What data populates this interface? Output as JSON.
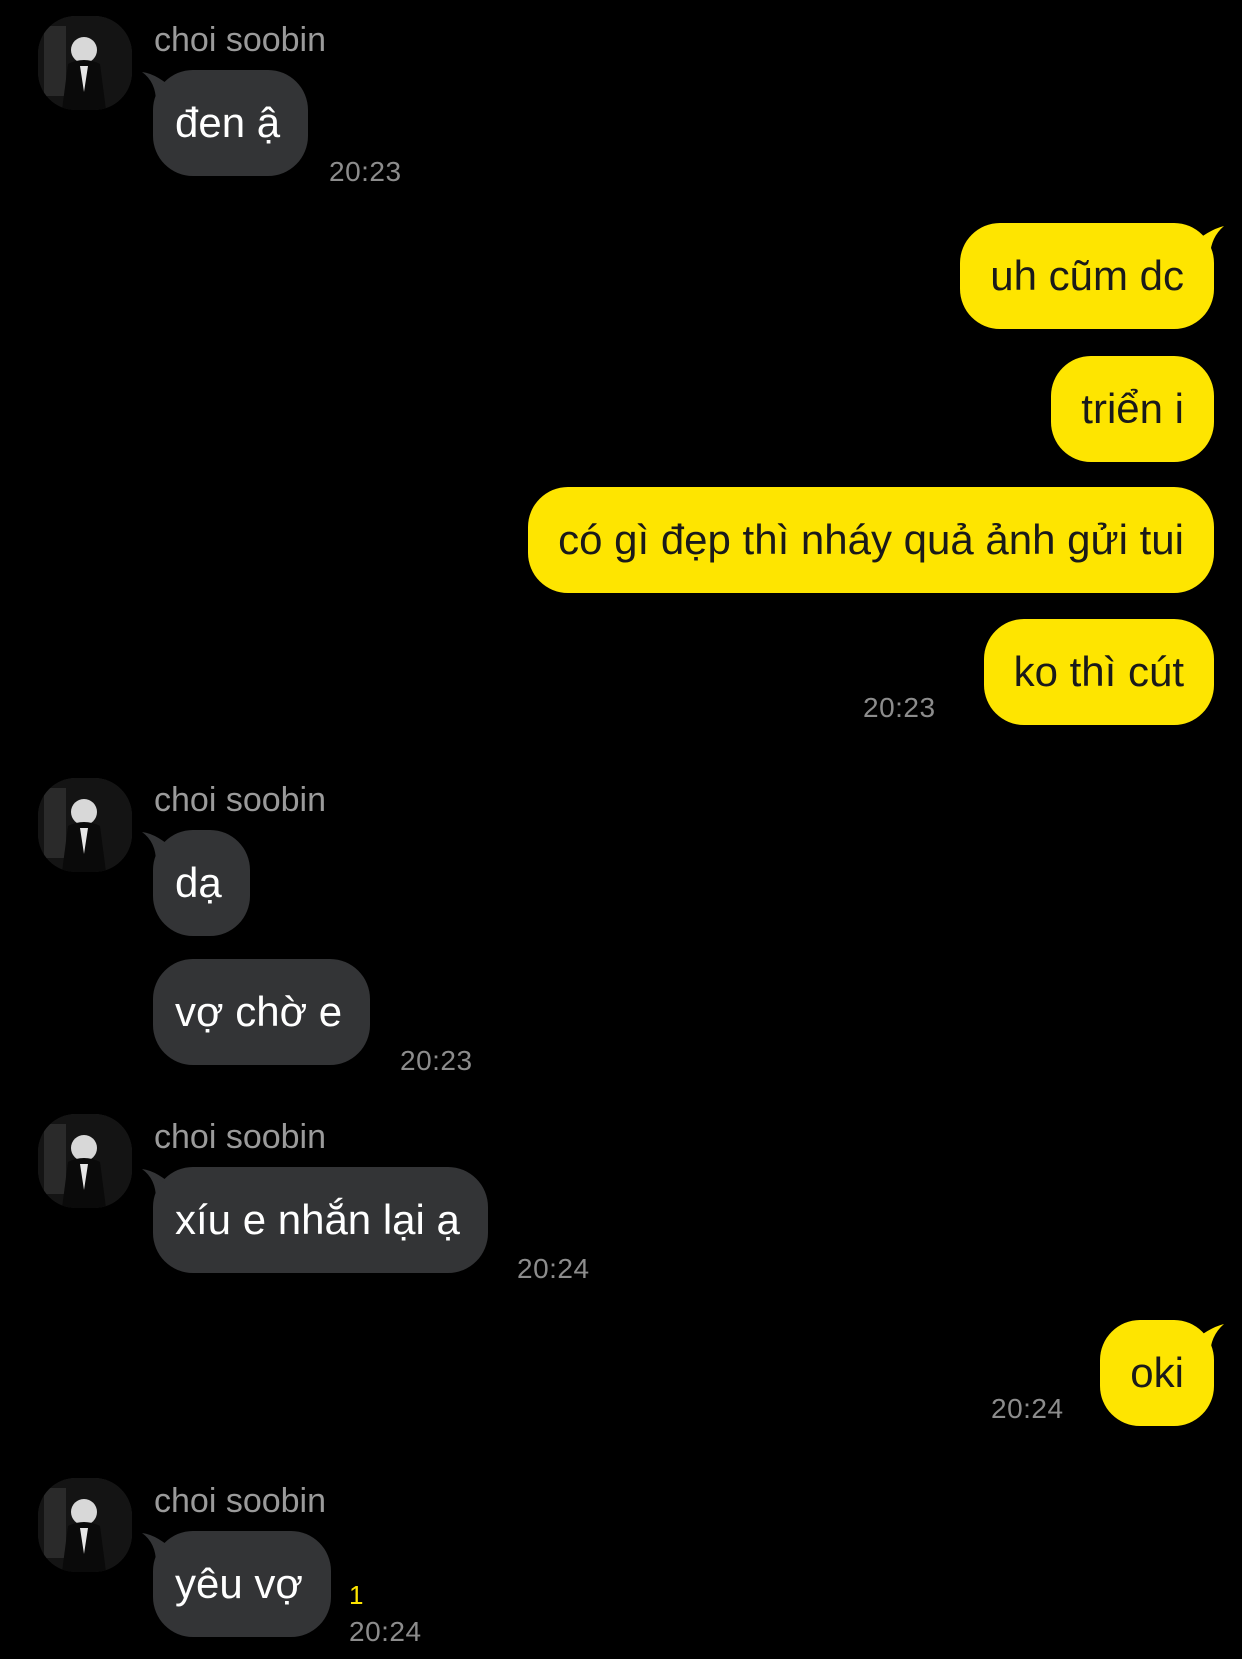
{
  "colors": {
    "background": "#000000",
    "incoming_bubble": "#333436",
    "outgoing_bubble": "#fee500",
    "unread_indicator": "#fee500",
    "muted_text": "#8c8c8c"
  },
  "groups": [
    {
      "direction": "incoming",
      "sender": "choi soobin",
      "avatar_icon": "profile-photo-icon",
      "messages": [
        "đen ậ"
      ],
      "time": "20:23"
    },
    {
      "direction": "outgoing",
      "messages": [
        "uh cũm dc",
        "triển i",
        "có gì đẹp thì nháy quả ảnh gửi tui",
        "ko thì cút"
      ],
      "time": "20:23"
    },
    {
      "direction": "incoming",
      "sender": "choi soobin",
      "avatar_icon": "profile-photo-icon",
      "messages": [
        "dạ",
        "vợ chờ e"
      ],
      "time": "20:23"
    },
    {
      "direction": "incoming",
      "sender": "choi soobin",
      "avatar_icon": "profile-photo-icon",
      "messages": [
        "xíu e nhắn lại ạ"
      ],
      "time": "20:24"
    },
    {
      "direction": "outgoing",
      "messages": [
        "oki"
      ],
      "time": "20:24"
    },
    {
      "direction": "incoming",
      "sender": "choi soobin",
      "avatar_icon": "profile-photo-icon",
      "messages": [
        "yêu vợ"
      ],
      "time": "20:24",
      "unread_count": "1"
    }
  ]
}
